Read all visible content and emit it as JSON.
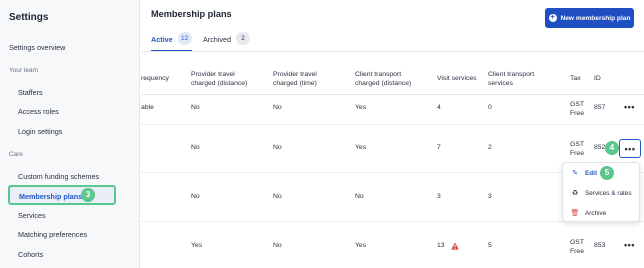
{
  "sidebar": {
    "title": "Settings",
    "overview": "Settings overview",
    "team_section": "Your team",
    "team_items": [
      "Staffers",
      "Access roles",
      "Login settings"
    ],
    "care_section": "Care",
    "care_items": [
      "Custom funding schemes",
      "Membership plans",
      "Services",
      "Matching preferences",
      "Cohorts"
    ],
    "active_step": "3"
  },
  "header": {
    "title": "Membership plans",
    "new_button_label": "New membership plan",
    "new_button_icon": "plus-circle-icon"
  },
  "tabs": [
    {
      "label": "Active",
      "count": "12"
    },
    {
      "label": "Archived",
      "count": "2"
    }
  ],
  "table": {
    "columns": [
      "requency",
      "Provider travel\ncharged (distance)",
      "Provider travel\ncharged (time)",
      "Client transport\ncharged (distance)",
      "Visit services",
      "Client transport\nservices",
      "Tax",
      "ID"
    ],
    "rows": [
      {
        "frequency": "able",
        "travel_distance": "No",
        "travel_time": "No",
        "transport_distance": "Yes",
        "visit_services": "4",
        "transport_services": "0",
        "tax": "GST\nFree",
        "id": "857",
        "warning": false
      },
      {
        "frequency": "",
        "travel_distance": "No",
        "travel_time": "No",
        "transport_distance": "Yes",
        "visit_services": "7",
        "transport_services": "2",
        "tax": "GST\nFree",
        "id": "852",
        "warning": false
      },
      {
        "frequency": "",
        "travel_distance": "No",
        "travel_time": "No",
        "transport_distance": "No",
        "visit_services": "3",
        "transport_services": "3",
        "tax": "",
        "id": "",
        "warning": false
      },
      {
        "frequency": "",
        "travel_distance": "Yes",
        "travel_time": "No",
        "transport_distance": "Yes",
        "visit_services": "13",
        "transport_services": "5",
        "tax": "GST\nFree",
        "id": "853",
        "warning": true
      }
    ],
    "more_label": "•••",
    "step_4": "4"
  },
  "menu": {
    "step_5": "5",
    "items": [
      {
        "label": "Edit",
        "icon": "pencil-icon"
      },
      {
        "label": "Services & rates",
        "icon": "recycle-icon"
      },
      {
        "label": "Archive",
        "icon": "trash-icon"
      }
    ]
  },
  "colors": {
    "primary": "#1f4fc2",
    "annotation": "#5cc68f",
    "warning": "#d64545"
  }
}
